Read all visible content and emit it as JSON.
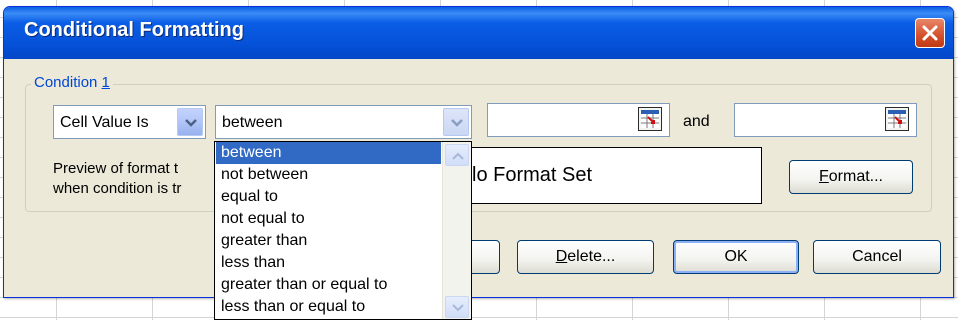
{
  "window": {
    "title": "Conditional Formatting"
  },
  "condition": {
    "legend_prefix": "Condition ",
    "legend_number": "1",
    "type_value": "Cell Value Is",
    "operator_value": "between",
    "and_label": "and",
    "preview_label_line1": "Preview of format t",
    "preview_label_line2": "when condition is tr",
    "preview_text": "lo Format Set",
    "format_button_prefix": "",
    "format_button_u": "F",
    "format_button_rest": "ormat..."
  },
  "dropdown": {
    "options": [
      "between",
      "not between",
      "equal to",
      "not equal to",
      "greater than",
      "less than",
      "greater than or equal to",
      "less than or equal to"
    ],
    "selected_index": 0
  },
  "buttons": {
    "delete_u": "D",
    "delete_rest": "elete...",
    "ok": "OK",
    "cancel": "Cancel"
  },
  "colors": {
    "title_bar": "#0552d8",
    "close_button": "#d3502b",
    "selection": "#316ac5",
    "legend_text": "#0046d5"
  },
  "icons": {
    "close": "close-icon",
    "dropdown_arrow": "chevron-down-icon",
    "range_picker": "range-select-icon"
  }
}
